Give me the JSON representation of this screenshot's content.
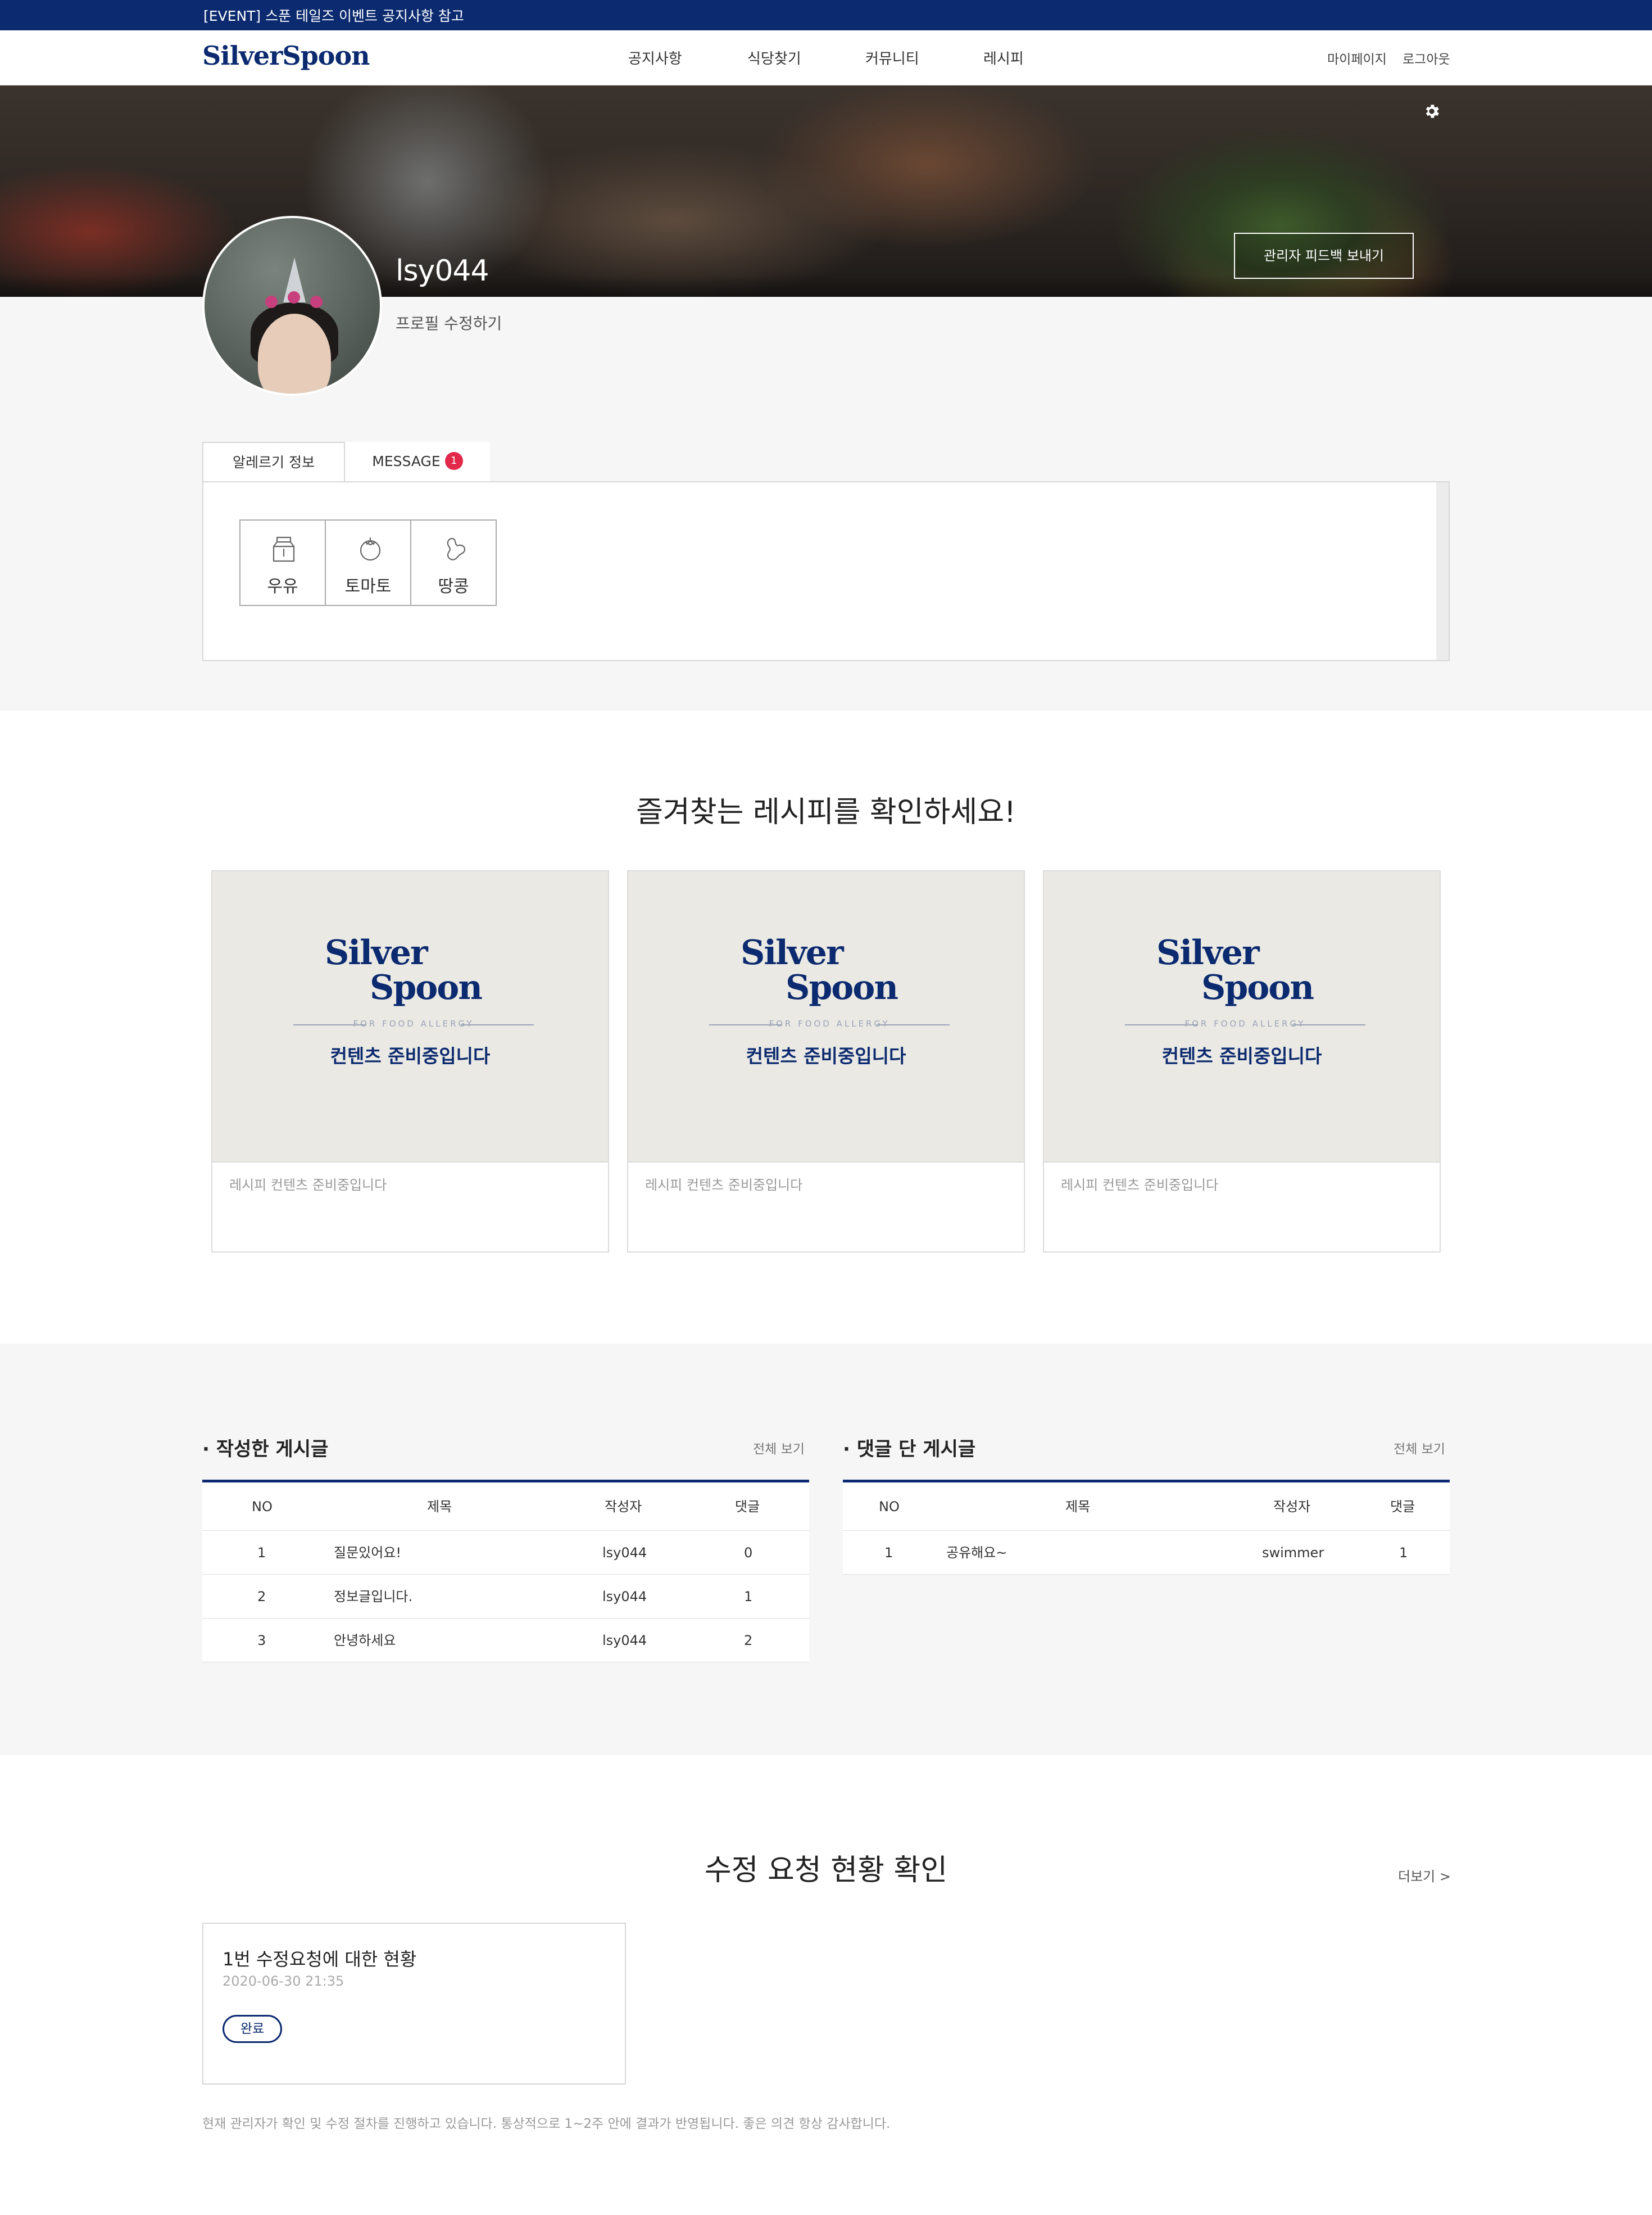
{
  "event_bar": {
    "text": "[EVENT] 스푼 테일즈 이벤트 공지사항 참고"
  },
  "header": {
    "logo": "SilverSpoon",
    "nav": [
      "공지사항",
      "식당찾기",
      "커뮤니티",
      "레시피"
    ],
    "util": [
      "마이페이지",
      "로그아웃"
    ]
  },
  "profile": {
    "username": "lsy044",
    "edit_label": "프로필 수정하기",
    "feedback_button": "관리자 피드백 보내기",
    "settings_icon": "gear-icon"
  },
  "tabs": {
    "allergy_tab": "알레르기 정보",
    "message_tab": "MESSAGE",
    "message_count": "1"
  },
  "allergies": [
    {
      "label": "우유",
      "icon": "milk-carton-icon"
    },
    {
      "label": "토마토",
      "icon": "tomato-icon"
    },
    {
      "label": "땅콩",
      "icon": "peanut-icon"
    }
  ],
  "favorites": {
    "title": "즐겨찾는 레시피를 확인하세요!",
    "cards": [
      {
        "logo_top": "Silver",
        "logo_bottom": "Spoon",
        "tagline": "FOR FOOD ALLERGY",
        "placeholder": "컨텐츠 준비중입니다",
        "desc": "레시피 컨텐츠 준비중입니다"
      },
      {
        "logo_top": "Silver",
        "logo_bottom": "Spoon",
        "tagline": "FOR FOOD ALLERGY",
        "placeholder": "컨텐츠 준비중입니다",
        "desc": "레시피 컨텐츠 준비중입니다"
      },
      {
        "logo_top": "Silver",
        "logo_bottom": "Spoon",
        "tagline": "FOR FOOD ALLERGY",
        "placeholder": "컨텐츠 준비중입니다",
        "desc": "레시피 컨텐츠 준비중입니다"
      }
    ]
  },
  "my_posts": {
    "title": "· 작성한 게시글",
    "see_all": "전체 보기",
    "columns": [
      "NO",
      "제목",
      "작성자",
      "댓글"
    ],
    "rows": [
      [
        "1",
        "질문있어요!",
        "lsy044",
        "0"
      ],
      [
        "2",
        "정보글입니다.",
        "lsy044",
        "1"
      ],
      [
        "3",
        "안녕하세요",
        "lsy044",
        "2"
      ]
    ]
  },
  "commented_posts": {
    "title": "· 댓글 단 게시글",
    "see_all": "전체 보기",
    "columns": [
      "NO",
      "제목",
      "작성자",
      "댓글"
    ],
    "rows": [
      [
        "1",
        "공유해요~",
        "swimmer",
        "1"
      ]
    ]
  },
  "modify_requests": {
    "title": "수정 요청 현황 확인",
    "more": "더보기 >",
    "card": {
      "title": "1번 수정요청에 대한 현황",
      "date": "2020-06-30 21:35",
      "status": "완료"
    },
    "notice": "현재 관리자가 확인 및 수정 절차를 진행하고 있습니다. 통상적으로 1~2주 안에 결과가 반영됩니다. 좋은 의견 항상 감사합니다."
  },
  "colors": {
    "brand": "#0b2a6f",
    "badge": "#e2294a",
    "section_bg": "#f6f6f6"
  }
}
